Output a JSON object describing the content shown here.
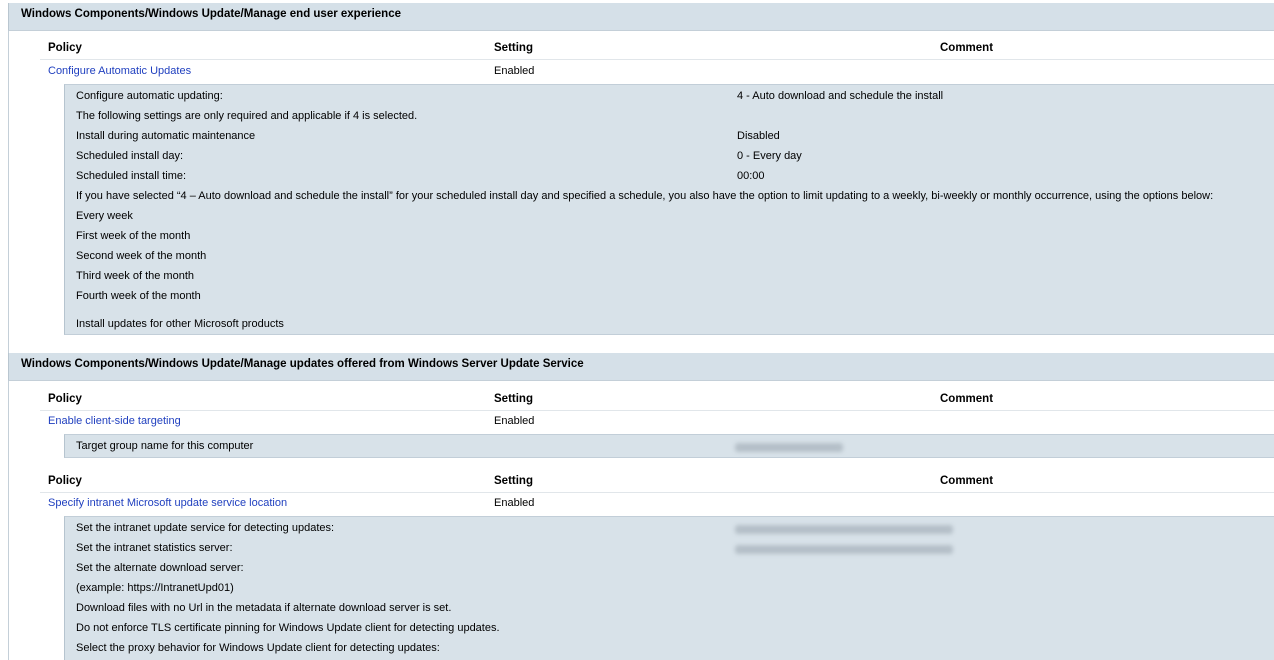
{
  "sections": [
    {
      "title": "Windows Components/Windows Update/Manage end user experience",
      "groups": [
        {
          "headers": {
            "policy": "Policy",
            "setting": "Setting",
            "comment": "Comment"
          },
          "policy": {
            "name": "Configure Automatic Updates",
            "setting": "Enabled"
          },
          "details": [
            {
              "label": "Configure automatic updating:",
              "value": "4 - Auto download and schedule the install"
            },
            {
              "label": "The following settings are only required and applicable if 4 is selected.",
              "value": ""
            },
            {
              "label": "Install during automatic maintenance",
              "value": "Disabled"
            },
            {
              "label": "Scheduled install day:",
              "value": "0 - Every day"
            },
            {
              "label": "Scheduled install time:",
              "value": "00:00"
            },
            {
              "label": "If you have selected “4 – Auto download and schedule the install” for your scheduled install day and specified a schedule, you also have the option to limit updating to a weekly, bi-weekly or monthly occurrence, using the options below:",
              "value": ""
            },
            {
              "label": "Every week",
              "value": ""
            },
            {
              "label": "First week of the month",
              "value": ""
            },
            {
              "label": "Second week of the month",
              "value": ""
            },
            {
              "label": "Third week of the month",
              "value": ""
            },
            {
              "label": "Fourth week of the month",
              "value": ""
            },
            {
              "label": "Install updates for other Microsoft products",
              "value": ""
            }
          ]
        }
      ]
    },
    {
      "title": "Windows Components/Windows Update/Manage updates offered from Windows Server Update Service",
      "groups": [
        {
          "headers": {
            "policy": "Policy",
            "setting": "Setting",
            "comment": "Comment"
          },
          "policy": {
            "name": "Enable client-side targeting",
            "setting": "Enabled"
          },
          "details": [
            {
              "label": "Target group name for this computer",
              "value": ""
            }
          ]
        },
        {
          "headers": {
            "policy": "Policy",
            "setting": "Setting",
            "comment": "Comment"
          },
          "policy": {
            "name": "Specify intranet Microsoft update service location",
            "setting": "Enabled"
          },
          "details": [
            {
              "label": "Set the intranet update service for detecting updates:",
              "value": ""
            },
            {
              "label": "Set the intranet statistics server:",
              "value": ""
            },
            {
              "label": "Set the alternate download server:",
              "value": ""
            },
            {
              "label": "(example: https://IntranetUpd01)",
              "value": ""
            },
            {
              "label": "Download files with no Url in the metadata if alternate download server is set.",
              "value": ""
            },
            {
              "label": "Do not enforce TLS certificate pinning for Windows Update client for detecting updates.",
              "value": ""
            },
            {
              "label": "Select the proxy behavior for Windows Update client for detecting updates:",
              "value": ""
            }
          ]
        }
      ]
    }
  ]
}
